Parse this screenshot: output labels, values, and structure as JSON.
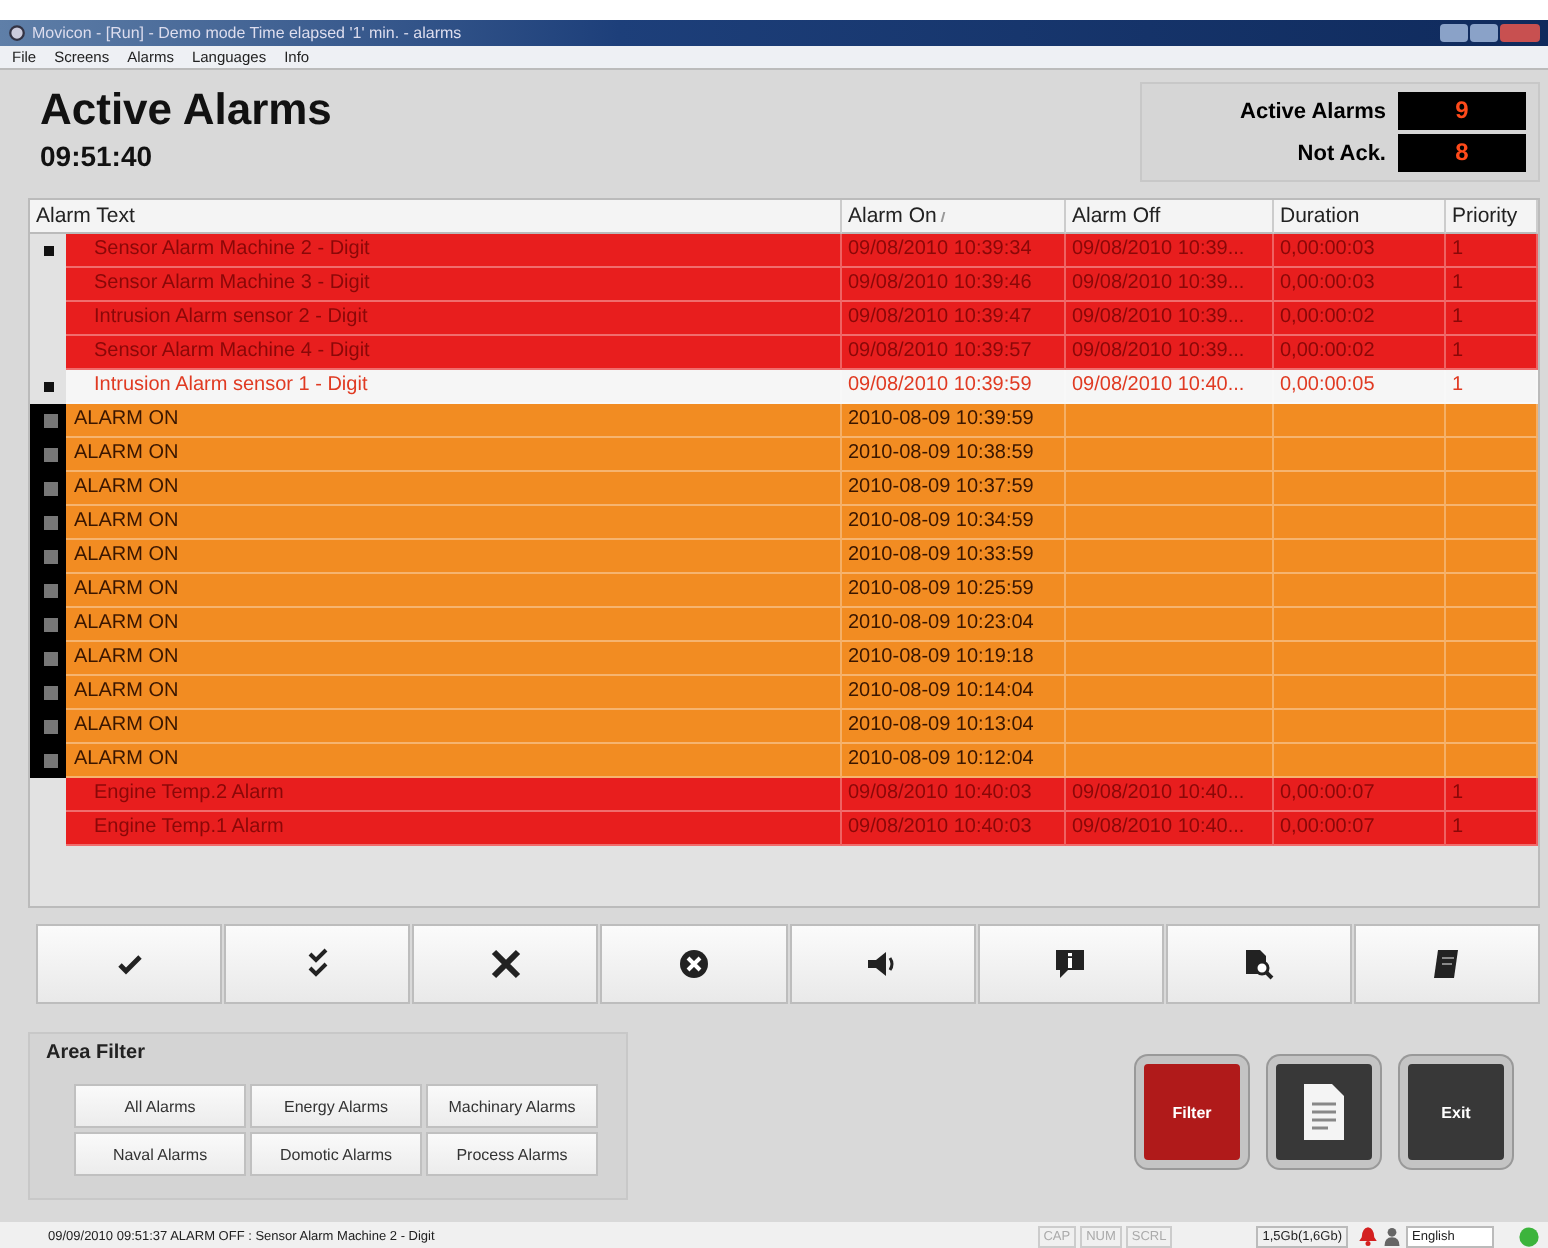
{
  "window": {
    "title": "Movicon - [Run] - Demo mode Time elapsed '1' min. - alarms"
  },
  "menu": [
    "File",
    "Screens",
    "Alarms",
    "Languages",
    "Info"
  ],
  "header": {
    "title": "Active Alarms",
    "time": "09:51:40",
    "counters": [
      {
        "label": "Active Alarms",
        "value": "9"
      },
      {
        "label": "Not Ack.",
        "value": "8"
      }
    ]
  },
  "table": {
    "columns": [
      {
        "label": "Alarm Text",
        "sorted": false
      },
      {
        "label": "Alarm On",
        "sorted": true
      },
      {
        "label": "Alarm Off",
        "sorted": false
      },
      {
        "label": "Duration",
        "sorted": false
      },
      {
        "label": "Priority",
        "sorted": false
      }
    ],
    "rows": [
      {
        "kind": "alarm",
        "flagged": true,
        "selected": false,
        "text": "Sensor Alarm Machine 2 - Digit",
        "on": "09/08/2010 10:39:34",
        "off": "09/08/2010 10:39...",
        "duration": "0,00:00:03",
        "priority": "1"
      },
      {
        "kind": "alarm",
        "flagged": false,
        "selected": false,
        "text": "Sensor Alarm Machine 3 - Digit",
        "on": "09/08/2010 10:39:46",
        "off": "09/08/2010 10:39...",
        "duration": "0,00:00:03",
        "priority": "1"
      },
      {
        "kind": "alarm",
        "flagged": false,
        "selected": false,
        "text": "Intrusion Alarm sensor 2 - Digit",
        "on": "09/08/2010 10:39:47",
        "off": "09/08/2010 10:39...",
        "duration": "0,00:00:02",
        "priority": "1"
      },
      {
        "kind": "alarm",
        "flagged": false,
        "selected": false,
        "text": "Sensor Alarm Machine 4 - Digit",
        "on": "09/08/2010 10:39:57",
        "off": "09/08/2010 10:39...",
        "duration": "0,00:00:02",
        "priority": "1"
      },
      {
        "kind": "alarm",
        "flagged": true,
        "selected": true,
        "text": "Intrusion Alarm sensor 1 - Digit",
        "on": "09/08/2010 10:39:59",
        "off": "09/08/2010 10:40...",
        "duration": "0,00:00:05",
        "priority": "1",
        "children": [
          {
            "kind": "event",
            "text": "ALARM ON",
            "on": "2010-08-09 10:39:59"
          },
          {
            "kind": "event",
            "text": "ALARM ON",
            "on": "2010-08-09 10:38:59"
          },
          {
            "kind": "event",
            "text": "ALARM ON",
            "on": "2010-08-09 10:37:59"
          },
          {
            "kind": "event",
            "text": "ALARM ON",
            "on": "2010-08-09 10:34:59"
          },
          {
            "kind": "event",
            "text": "ALARM ON",
            "on": "2010-08-09 10:33:59"
          },
          {
            "kind": "event",
            "text": "ALARM ON",
            "on": "2010-08-09 10:25:59"
          },
          {
            "kind": "event",
            "text": "ALARM ON",
            "on": "2010-08-09 10:23:04"
          },
          {
            "kind": "event",
            "text": "ALARM ON",
            "on": "2010-08-09 10:19:18"
          },
          {
            "kind": "event",
            "text": "ALARM ON",
            "on": "2010-08-09 10:14:04"
          },
          {
            "kind": "event",
            "text": "ALARM ON",
            "on": "2010-08-09 10:13:04"
          },
          {
            "kind": "event",
            "text": "ALARM ON",
            "on": "2010-08-09 10:12:04"
          }
        ]
      },
      {
        "kind": "alarm",
        "flagged": false,
        "selected": false,
        "text": "Engine Temp.2 Alarm",
        "on": "09/08/2010 10:40:03",
        "off": "09/08/2010 10:40...",
        "duration": "0,00:00:07",
        "priority": "1"
      },
      {
        "kind": "alarm",
        "flagged": false,
        "selected": false,
        "text": "Engine Temp.1 Alarm",
        "on": "09/08/2010 10:40:03",
        "off": "09/08/2010 10:40...",
        "duration": "0,00:00:07",
        "priority": "1"
      }
    ]
  },
  "area_filter": {
    "title": "Area Filter",
    "buttons": [
      "All Alarms",
      "Energy Alarms",
      "Machinary Alarms",
      "Naval Alarms",
      "Domotic Alarms",
      "Process Alarms"
    ]
  },
  "big_buttons": [
    {
      "kind": "text",
      "label": "Filter",
      "color": "#b01a1a"
    },
    {
      "kind": "icon",
      "color": "#383838"
    },
    {
      "kind": "text",
      "label": "Exit",
      "color": "#383838"
    }
  ],
  "status_bar": {
    "message": "09/09/2010 09:51:37 ALARM OFF : Sensor Alarm Machine 2 - Digit",
    "indicators": [
      {
        "label": "CAP",
        "on": false
      },
      {
        "label": "NUM",
        "on": false
      },
      {
        "label": "SCRL",
        "on": false
      }
    ],
    "memory": "1,5Gb(1,6Gb)",
    "language": "English"
  }
}
